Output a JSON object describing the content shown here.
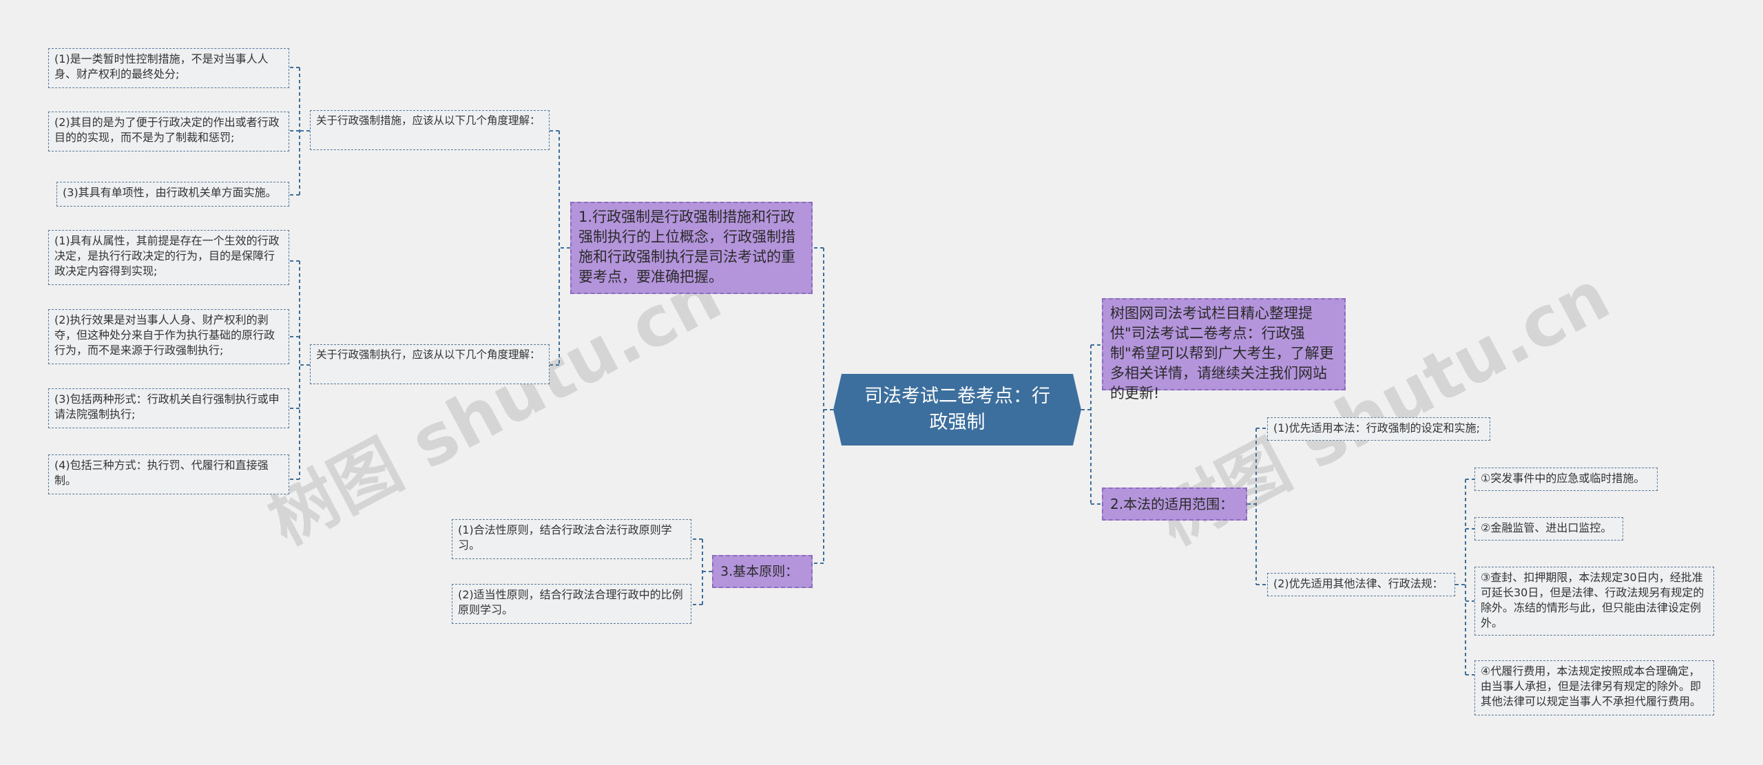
{
  "root": "司法考试二卷考点：行政强制",
  "left": {
    "branch1": {
      "label": "1.行政强制是行政强制措施和行政强制执行的上位概念，行政强制措施和行政强制执行是司法考试的重要考点，要准确把握。",
      "sub1": {
        "label": "关于行政强制措施，应该从以下几个角度理解：",
        "items": [
          "(1)是一类暂时性控制措施，不是对当事人人身、财产权利的最终处分;",
          "(2)其目的是为了便于行政决定的作出或者行政目的的实现，而不是为了制裁和惩罚;",
          "(3)其具有单项性，由行政机关单方面实施。"
        ]
      },
      "sub2": {
        "label": "关于行政强制执行，应该从以下几个角度理解：",
        "items": [
          "(1)具有从属性，其前提是存在一个生效的行政决定，是执行行政决定的行为，目的是保障行政决定内容得到实现;",
          "(2)执行效果是对当事人人身、财产权利的剥夺，但这种处分来自于作为执行基础的原行政行为，而不是来源于行政强制执行;",
          "(3)包括两种形式：行政机关自行强制执行或申请法院强制执行;",
          "(4)包括三种方式：执行罚、代履行和直接强制。"
        ]
      }
    },
    "branch3": {
      "label": "3.基本原则：",
      "items": [
        "(1)合法性原则，结合行政法合法行政原则学习。",
        "(2)适当性原则，结合行政法合理行政中的比例原则学习。"
      ]
    }
  },
  "right": {
    "intro": "树图网司法考试栏目精心整理提供\"司法考试二卷考点：行政强制\"希望可以帮到广大考生，了解更多相关详情，请继续关注我们网站的更新!",
    "branch2": {
      "label": "2.本法的适用范围：",
      "sub1": "(1)优先适用本法：行政强制的设定和实施;",
      "sub2": {
        "label": "(2)优先适用其他法律、行政法规：",
        "items": [
          "①突发事件中的应急或临时措施。",
          "②金融监管、进出口监控。",
          "③查封、扣押期限，本法规定30日内，经批准可延长30日，但是法律、行政法规另有规定的除外。冻结的情形与此，但只能由法律设定例外。",
          "④代履行费用，本法规定按照成本合理确定，由当事人承担，但是法律另有规定的除外。即其他法律可以规定当事人不承担代履行费用。"
        ]
      }
    }
  },
  "watermarks": [
    "树图 shutu.cn",
    "树图 shutu.cn"
  ],
  "colors": {
    "root": "#3c6f9d",
    "purple": "#b495dc",
    "edge": "#3c6f9d",
    "background": "#f0f0f1"
  }
}
